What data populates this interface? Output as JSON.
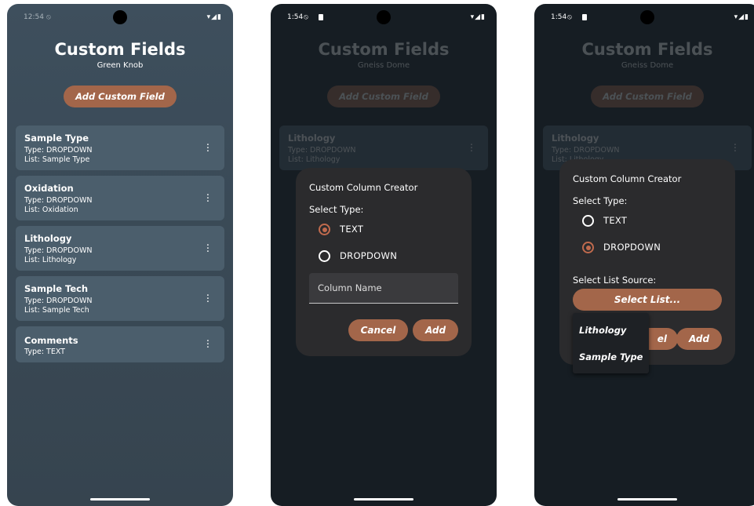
{
  "phone1": {
    "status": {
      "time": "12:54"
    },
    "title": "Custom Fields",
    "subtitle": "Green Knob",
    "add_button": "Add Custom Field",
    "fields": [
      {
        "name": "Sample Type",
        "type": "Type: DROPDOWN",
        "list": "List: Sample Type"
      },
      {
        "name": "Oxidation",
        "type": "Type: DROPDOWN",
        "list": "List: Oxidation"
      },
      {
        "name": "Lithology",
        "type": "Type: DROPDOWN",
        "list": "List: Lithology"
      },
      {
        "name": "Sample Tech",
        "type": "Type: DROPDOWN",
        "list": "List: Sample Tech"
      },
      {
        "name": "Comments",
        "type": "Type: TEXT"
      }
    ]
  },
  "phone2": {
    "status": {
      "time": "1:54"
    },
    "title": "Custom Fields",
    "subtitle": "Gneiss Dome",
    "add_button": "Add Custom Field",
    "background_card": {
      "name": "Lithology",
      "type": "Type: DROPDOWN",
      "list": "List: Lithology"
    },
    "dialog": {
      "title": "Custom Column Creator",
      "select_type_label": "Select Type:",
      "options": [
        "TEXT",
        "DROPDOWN"
      ],
      "selected_option": "TEXT",
      "column_name_placeholder": "Column Name",
      "cancel_label": "Cancel",
      "add_label": "Add"
    }
  },
  "phone3": {
    "status": {
      "time": "1:54"
    },
    "title": "Custom Fields",
    "subtitle": "Gneiss Dome",
    "add_button": "Add Custom Field",
    "background_card": {
      "name": "Lithology",
      "type": "Type: DROPDOWN",
      "list": "List: Lithology"
    },
    "dialog": {
      "title": "Custom Column Creator",
      "select_type_label": "Select Type:",
      "options": [
        "TEXT",
        "DROPDOWN"
      ],
      "selected_option": "DROPDOWN",
      "list_source_label": "Select List Source:",
      "select_list_button": "Select List...",
      "cancel_partial": "el",
      "add_label": "Add"
    },
    "dropdown_menu": [
      "Lithology",
      "Sample Type"
    ]
  },
  "colors": {
    "accent": "#a3664a",
    "radio_selected": "#c06a4d",
    "list_bg": "#3e4f5d",
    "card_bg": "#4b5e6c",
    "dark_bg": "#161d23",
    "dialog_bg": "#2b2b2d"
  },
  "icons": [
    "dnd-icon",
    "sim-icon",
    "wifi-icon",
    "signal-icon",
    "battery-icon",
    "more-vert-icon"
  ]
}
